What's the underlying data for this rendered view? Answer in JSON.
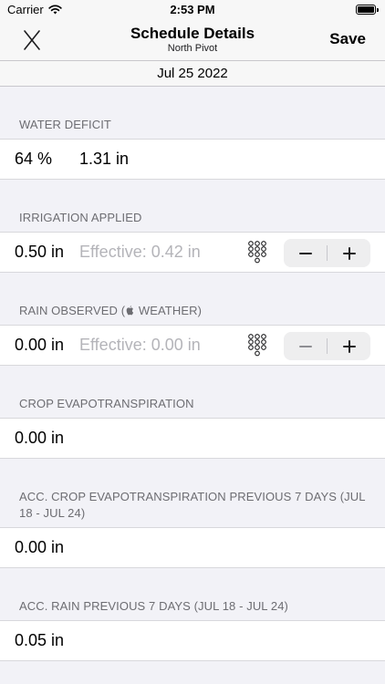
{
  "status_bar": {
    "carrier": "Carrier",
    "time": "2:53 PM",
    "icons": [
      "wifi-icon",
      "battery-icon"
    ]
  },
  "nav": {
    "title": "Schedule Details",
    "subtitle": "North Pivot",
    "save_label": "Save",
    "close_icon": "close-icon"
  },
  "date": "Jul 25 2022",
  "sections": {
    "water_deficit": {
      "header": "WATER DEFICIT",
      "percent": "64 %",
      "inches": "1.31 in"
    },
    "irrigation_applied": {
      "header": "IRRIGATION APPLIED",
      "value": "0.50 in",
      "effective": "Effective: 0.42 in",
      "minus_enabled": true,
      "plus_enabled": true
    },
    "rain_observed": {
      "header_before": "RAIN OBSERVED (",
      "header_icon": "apple-logo-icon",
      "header_after": " WEATHER)",
      "value": "0.00 in",
      "effective": "Effective: 0.00 in",
      "minus_enabled": false,
      "plus_enabled": true
    },
    "crop_et": {
      "header": "CROP EVAPOTRANSPIRATION",
      "value": "0.00 in"
    },
    "acc_crop_et": {
      "header": "ACC. CROP EVAPOTRANSPIRATION PREVIOUS 7 DAYS (JUL 18 - JUL 24)",
      "value": "0.00 in"
    },
    "acc_rain": {
      "header": "ACC. RAIN PREVIOUS 7 DAYS (JUL 18 - JUL 24)",
      "value": "0.05 in"
    }
  },
  "colors": {
    "background": "#f2f2f7",
    "cell": "#ffffff",
    "section_header_text": "#6d6d72",
    "effective_text": "#b4b4b9",
    "stepper_bg": "#eeeeef"
  }
}
